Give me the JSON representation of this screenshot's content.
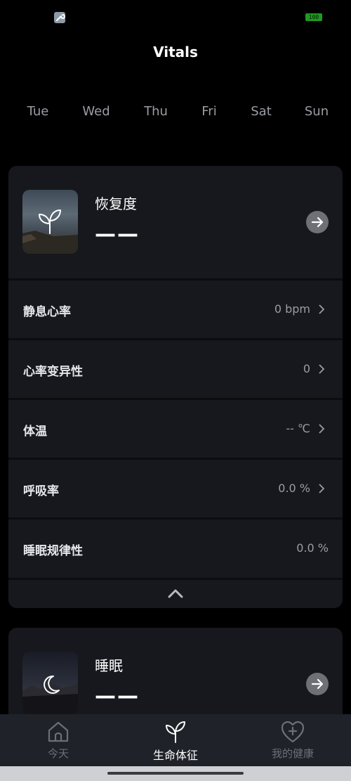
{
  "status_bar": {
    "battery": "100"
  },
  "header": {
    "title": "Vitals"
  },
  "days": [
    "Tue",
    "Wed",
    "Thu",
    "Fri",
    "Sat",
    "Sun"
  ],
  "recovery": {
    "title": "恢复度",
    "value": "——",
    "metrics": [
      {
        "label": "静息心率",
        "value": "0 bpm",
        "has_arrow": true
      },
      {
        "label": "心率变异性",
        "value": "0",
        "has_arrow": true
      },
      {
        "label": "体温",
        "value": "-- ℃",
        "has_arrow": true
      },
      {
        "label": "呼吸率",
        "value": "0.0 %",
        "has_arrow": true
      },
      {
        "label": "睡眠规律性",
        "value": "0.0 %",
        "has_arrow": false
      }
    ]
  },
  "sleep": {
    "title": "睡眠",
    "value": "——"
  },
  "tabs": [
    {
      "label": "今天",
      "icon": "home-icon",
      "active": false
    },
    {
      "label": "生命体征",
      "icon": "sprout-icon",
      "active": true
    },
    {
      "label": "我的健康",
      "icon": "heart-plus-icon",
      "active": false
    }
  ],
  "colors": {
    "background": "#000000",
    "card": "#17181d",
    "tab_bar": "#1f2228",
    "muted_text": "#9a9da4"
  }
}
